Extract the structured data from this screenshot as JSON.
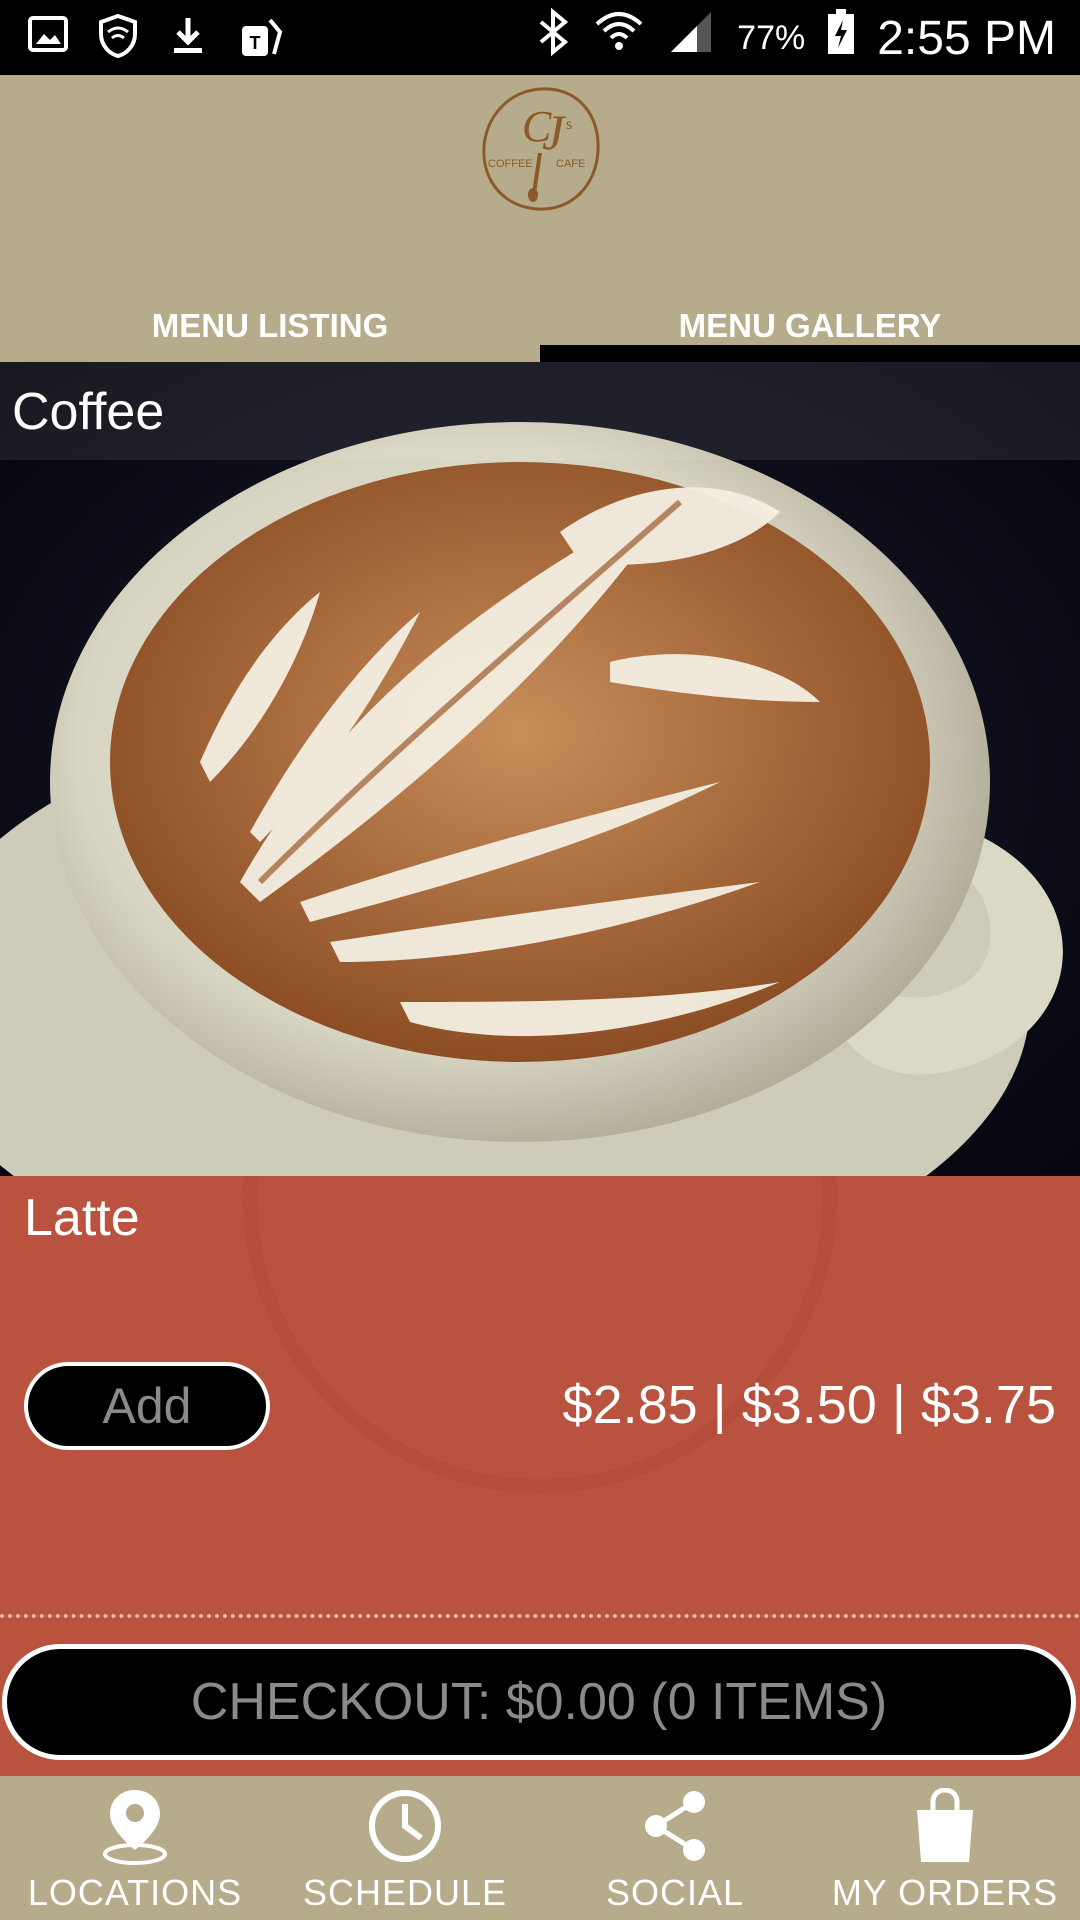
{
  "status_bar": {
    "battery_percent": "77%",
    "time": "2:55 PM"
  },
  "header": {
    "logo_text_main": "CJ",
    "logo_text_sub_left": "COFFEE",
    "logo_text_sub_right": "CAFE",
    "logo_superscript": "s",
    "tabs": [
      {
        "label": "MENU LISTING",
        "selected": false
      },
      {
        "label": "MENU GALLERY",
        "selected": true
      }
    ]
  },
  "gallery": {
    "category": "Coffee"
  },
  "item": {
    "name": "Latte",
    "add_label": "Add",
    "prices": "$2.85 | $3.50 | $3.75"
  },
  "checkout": {
    "label": "CHECKOUT: $0.00 (0 ITEMS)"
  },
  "bottom_nav": {
    "items": [
      {
        "label": "LOCATIONS",
        "icon": "location-pin-icon"
      },
      {
        "label": "SCHEDULE",
        "icon": "clock-icon"
      },
      {
        "label": "SOCIAL",
        "icon": "share-icon"
      },
      {
        "label": "MY ORDERS",
        "icon": "shopping-bag-icon"
      }
    ]
  },
  "colors": {
    "header_bg": "#b6ab8a",
    "panel_bg": "#b9533f",
    "button_bg": "#000000"
  }
}
